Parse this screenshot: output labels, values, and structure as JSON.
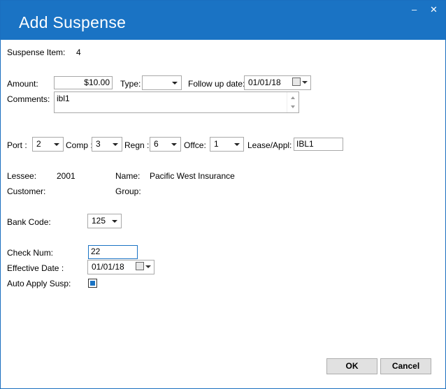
{
  "window": {
    "title": "Add Suspense",
    "minimize_glyph": "–",
    "close_glyph": "✕"
  },
  "suspense_item": {
    "label": "Suspense Item:",
    "value": "4"
  },
  "amount": {
    "label": "Amount:",
    "value": "$10.00"
  },
  "type": {
    "label": "Type:",
    "value": ""
  },
  "follow_up": {
    "label": "Follow up date:",
    "value": "01/01/18"
  },
  "comments": {
    "label": "Comments:",
    "value": "ibl1"
  },
  "port": {
    "label": "Port :",
    "value": "2"
  },
  "comp": {
    "label": "Comp :",
    "value": "3"
  },
  "regn": {
    "label": "Regn :",
    "value": "6"
  },
  "office": {
    "label": "Offce:",
    "value": "1"
  },
  "lease": {
    "label": "Lease/Appl:",
    "value": "IBL1"
  },
  "lessee": {
    "label": "Lessee:",
    "value": "2001"
  },
  "name": {
    "label": "Name:",
    "value": "Pacific West Insurance"
  },
  "customer": {
    "label": "Customer:",
    "value": ""
  },
  "group": {
    "label": "Group:",
    "value": ""
  },
  "bank_code": {
    "label": "Bank Code:",
    "value": "125"
  },
  "check_num": {
    "label": "Check Num:",
    "value": "22"
  },
  "effective_date": {
    "label": "Effective Date :",
    "value": "01/01/18"
  },
  "auto_apply": {
    "label": "Auto Apply Susp:",
    "checked": true
  },
  "buttons": {
    "ok": "OK",
    "cancel": "Cancel"
  },
  "colors": {
    "titlebar": "#1a73c4",
    "focus_border": "#1a73c4"
  },
  "icons": [
    "calendar-icon",
    "chevron-down-icon",
    "minimize-icon",
    "close-icon",
    "scroll-up-icon",
    "scroll-down-icon"
  ]
}
